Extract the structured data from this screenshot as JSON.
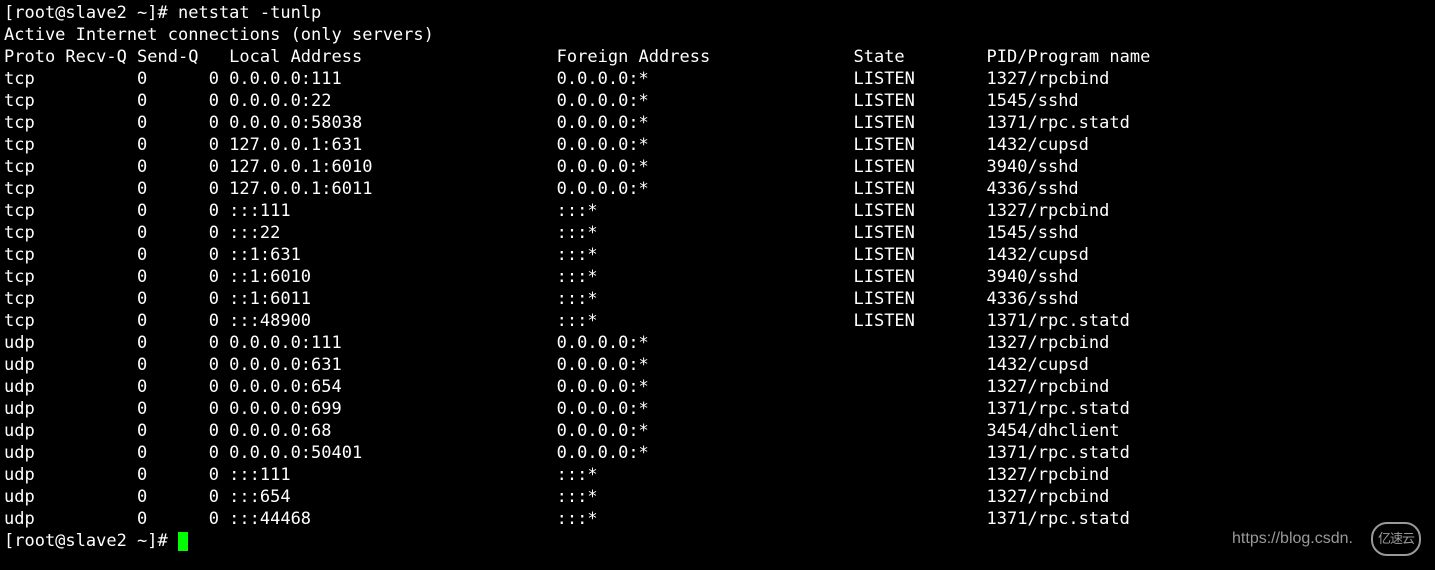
{
  "prompt1": "[root@slave2 ~]# ",
  "command": "netstat -tunlp",
  "header": "Active Internet connections (only servers)",
  "columns": {
    "proto": "Proto",
    "recvq": "Recv-Q",
    "sendq": "Send-Q",
    "local": "Local Address",
    "foreign": "Foreign Address",
    "state": "State",
    "pid": "PID/Program name"
  },
  "rows": [
    {
      "proto": "tcp",
      "recvq": "0",
      "sendq": "0",
      "local": "0.0.0.0:111",
      "foreign": "0.0.0.0:*",
      "state": "LISTEN",
      "pid": "1327/rpcbind"
    },
    {
      "proto": "tcp",
      "recvq": "0",
      "sendq": "0",
      "local": "0.0.0.0:22",
      "foreign": "0.0.0.0:*",
      "state": "LISTEN",
      "pid": "1545/sshd"
    },
    {
      "proto": "tcp",
      "recvq": "0",
      "sendq": "0",
      "local": "0.0.0.0:58038",
      "foreign": "0.0.0.0:*",
      "state": "LISTEN",
      "pid": "1371/rpc.statd"
    },
    {
      "proto": "tcp",
      "recvq": "0",
      "sendq": "0",
      "local": "127.0.0.1:631",
      "foreign": "0.0.0.0:*",
      "state": "LISTEN",
      "pid": "1432/cupsd"
    },
    {
      "proto": "tcp",
      "recvq": "0",
      "sendq": "0",
      "local": "127.0.0.1:6010",
      "foreign": "0.0.0.0:*",
      "state": "LISTEN",
      "pid": "3940/sshd"
    },
    {
      "proto": "tcp",
      "recvq": "0",
      "sendq": "0",
      "local": "127.0.0.1:6011",
      "foreign": "0.0.0.0:*",
      "state": "LISTEN",
      "pid": "4336/sshd"
    },
    {
      "proto": "tcp",
      "recvq": "0",
      "sendq": "0",
      "local": ":::111",
      "foreign": ":::*",
      "state": "LISTEN",
      "pid": "1327/rpcbind"
    },
    {
      "proto": "tcp",
      "recvq": "0",
      "sendq": "0",
      "local": ":::22",
      "foreign": ":::*",
      "state": "LISTEN",
      "pid": "1545/sshd"
    },
    {
      "proto": "tcp",
      "recvq": "0",
      "sendq": "0",
      "local": "::1:631",
      "foreign": ":::*",
      "state": "LISTEN",
      "pid": "1432/cupsd"
    },
    {
      "proto": "tcp",
      "recvq": "0",
      "sendq": "0",
      "local": "::1:6010",
      "foreign": ":::*",
      "state": "LISTEN",
      "pid": "3940/sshd"
    },
    {
      "proto": "tcp",
      "recvq": "0",
      "sendq": "0",
      "local": "::1:6011",
      "foreign": ":::*",
      "state": "LISTEN",
      "pid": "4336/sshd"
    },
    {
      "proto": "tcp",
      "recvq": "0",
      "sendq": "0",
      "local": ":::48900",
      "foreign": ":::*",
      "state": "LISTEN",
      "pid": "1371/rpc.statd"
    },
    {
      "proto": "udp",
      "recvq": "0",
      "sendq": "0",
      "local": "0.0.0.0:111",
      "foreign": "0.0.0.0:*",
      "state": "",
      "pid": "1327/rpcbind"
    },
    {
      "proto": "udp",
      "recvq": "0",
      "sendq": "0",
      "local": "0.0.0.0:631",
      "foreign": "0.0.0.0:*",
      "state": "",
      "pid": "1432/cupsd"
    },
    {
      "proto": "udp",
      "recvq": "0",
      "sendq": "0",
      "local": "0.0.0.0:654",
      "foreign": "0.0.0.0:*",
      "state": "",
      "pid": "1327/rpcbind"
    },
    {
      "proto": "udp",
      "recvq": "0",
      "sendq": "0",
      "local": "0.0.0.0:699",
      "foreign": "0.0.0.0:*",
      "state": "",
      "pid": "1371/rpc.statd"
    },
    {
      "proto": "udp",
      "recvq": "0",
      "sendq": "0",
      "local": "0.0.0.0:68",
      "foreign": "0.0.0.0:*",
      "state": "",
      "pid": "3454/dhclient"
    },
    {
      "proto": "udp",
      "recvq": "0",
      "sendq": "0",
      "local": "0.0.0.0:50401",
      "foreign": "0.0.0.0:*",
      "state": "",
      "pid": "1371/rpc.statd"
    },
    {
      "proto": "udp",
      "recvq": "0",
      "sendq": "0",
      "local": ":::111",
      "foreign": ":::*",
      "state": "",
      "pid": "1327/rpcbind"
    },
    {
      "proto": "udp",
      "recvq": "0",
      "sendq": "0",
      "local": ":::654",
      "foreign": ":::*",
      "state": "",
      "pid": "1327/rpcbind"
    },
    {
      "proto": "udp",
      "recvq": "0",
      "sendq": "0",
      "local": ":::44468",
      "foreign": ":::*",
      "state": "",
      "pid": "1371/rpc.statd"
    }
  ],
  "prompt2": "[root@slave2 ~]# ",
  "watermark_text": "https://blog.csdn.",
  "watermark_logo": "亿速云",
  "col_widths": {
    "proto": 8,
    "recvq": 7,
    "sendq": 7,
    "local": 32,
    "foreign": 29,
    "state": 13,
    "pid": 20
  }
}
